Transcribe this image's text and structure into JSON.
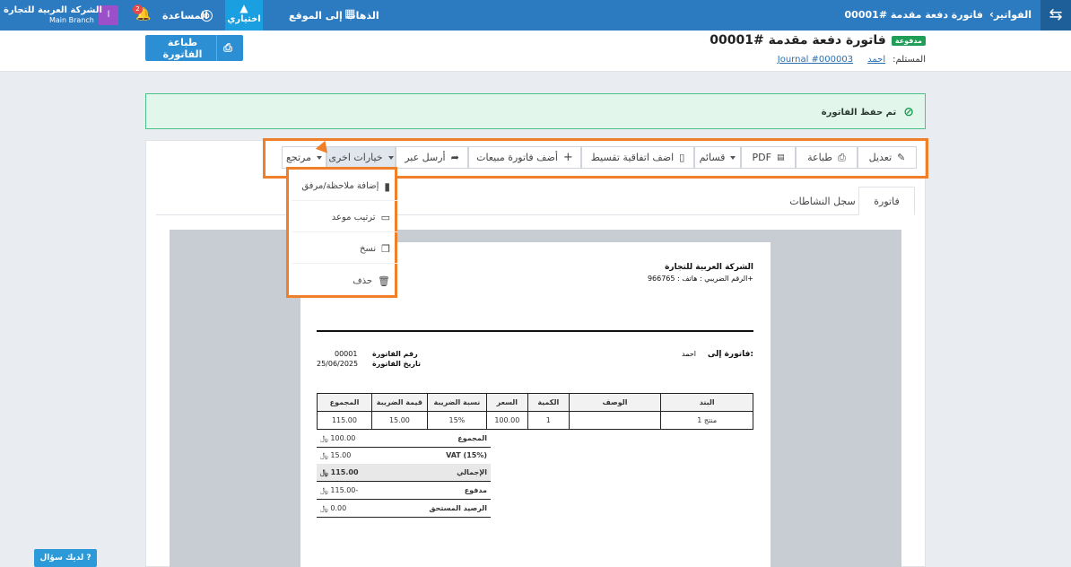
{
  "topbar": {
    "breadcrumb_root": "الفواتير",
    "breadcrumb_current": "فاتورة دفعة مقدمة #00001",
    "go_to_site": "الذهاب إلى الموقع",
    "trial": "اختياري",
    "help": "المساعدة",
    "notifications_count": "2",
    "company_name": "الشركة العربية للتجارة",
    "branch": "Main Branch",
    "avatar_initial": "ا"
  },
  "header": {
    "title": "فاتورة دفعة مقدمة #00001",
    "status": "مدفوعة",
    "recipient_label": "المستلم:",
    "recipient": "احمد",
    "journal": "Journal #000003",
    "print_button": "طباعة الفاتورة"
  },
  "alert": {
    "message": "تم حفظ الفاتورة"
  },
  "toolbar": {
    "edit": "تعديل",
    "print": "طباعة",
    "pdf": "PDF",
    "vouchers": "قسائم",
    "installment": "اضف اتفاقية تقسيط",
    "add_sales_invoice": "أضف فاتورة مبيعات",
    "send_via": "أرسل عبر",
    "more_options": "خيارات اخرى",
    "refund": "مرتجع"
  },
  "dropdown": {
    "items": [
      "إضافة ملاحظة/مرفق",
      "ترتيب موعد",
      "نسخ",
      "حذف"
    ]
  },
  "tabs": {
    "invoice": "فاتورة",
    "activity_log": "سجل النشاطات"
  },
  "invoice": {
    "company": "الشركة العربية للتجارة",
    "tax_phone": "الرقم الضريبي : هاتف : 966765+",
    "bill_to_label": "فاتورة إلى:",
    "bill_to": "احمد",
    "number_label": "رقم الفاتورة",
    "number": "00001",
    "date_label": "تاريخ الفاتورة",
    "date": "25/06/2025",
    "columns": [
      "البند",
      "الوصف",
      "الكمية",
      "السعر",
      "نسبة الضريبة",
      "قيمة الضريبة",
      "المجموع"
    ],
    "rows": [
      [
        "منتج 1",
        "",
        "1",
        "100.00",
        "15%",
        "15.00",
        "115.00"
      ]
    ],
    "totals": [
      {
        "label": "المجموع",
        "value": "100.00 ﷼"
      },
      {
        "label": "VAT (15%)",
        "value": "15.00 ﷼"
      },
      {
        "label": "الإجمالي",
        "value": "115.00 ﷼"
      },
      {
        "label": "مدفوع",
        "value": "-115.00 ﷼"
      },
      {
        "label": "الرصيد المستحق",
        "value": "0.00 ﷼"
      }
    ]
  },
  "help_widget": {
    "label": "لديك سؤال"
  }
}
